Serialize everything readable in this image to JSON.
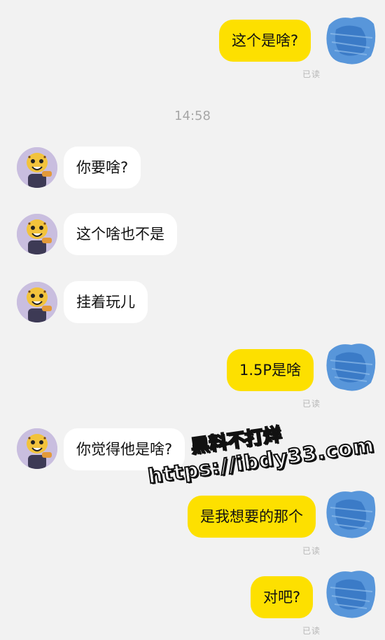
{
  "chat": {
    "time_divider": "14:58",
    "read_label": "已读",
    "messages": [
      {
        "side": "sent",
        "text": "这个是啥?"
      },
      {
        "side": "recv",
        "text": "你要啥?"
      },
      {
        "side": "recv",
        "text": "这个啥也不是"
      },
      {
        "side": "recv",
        "text": "挂着玩儿"
      },
      {
        "side": "sent",
        "text": "1.5P是啥"
      },
      {
        "side": "recv",
        "text": "你觉得他是啥?"
      },
      {
        "side": "sent",
        "text": "是我想要的那个"
      },
      {
        "side": "sent",
        "text": "对吧?"
      }
    ]
  },
  "watermark": {
    "line1": "黑料不打烊",
    "line2": "https://ibdy33.com"
  },
  "colors": {
    "sent_bubble": "#fde000",
    "recv_bubble": "#ffffff",
    "background": "#f2f2f2",
    "read_text": "#b7b7b7",
    "self_avatar_blur": "#3d86d6"
  },
  "icons": {
    "contact_avatar": "cartoon-cheetah-avatar-icon",
    "self_avatar": "blurred-avatar-icon"
  }
}
